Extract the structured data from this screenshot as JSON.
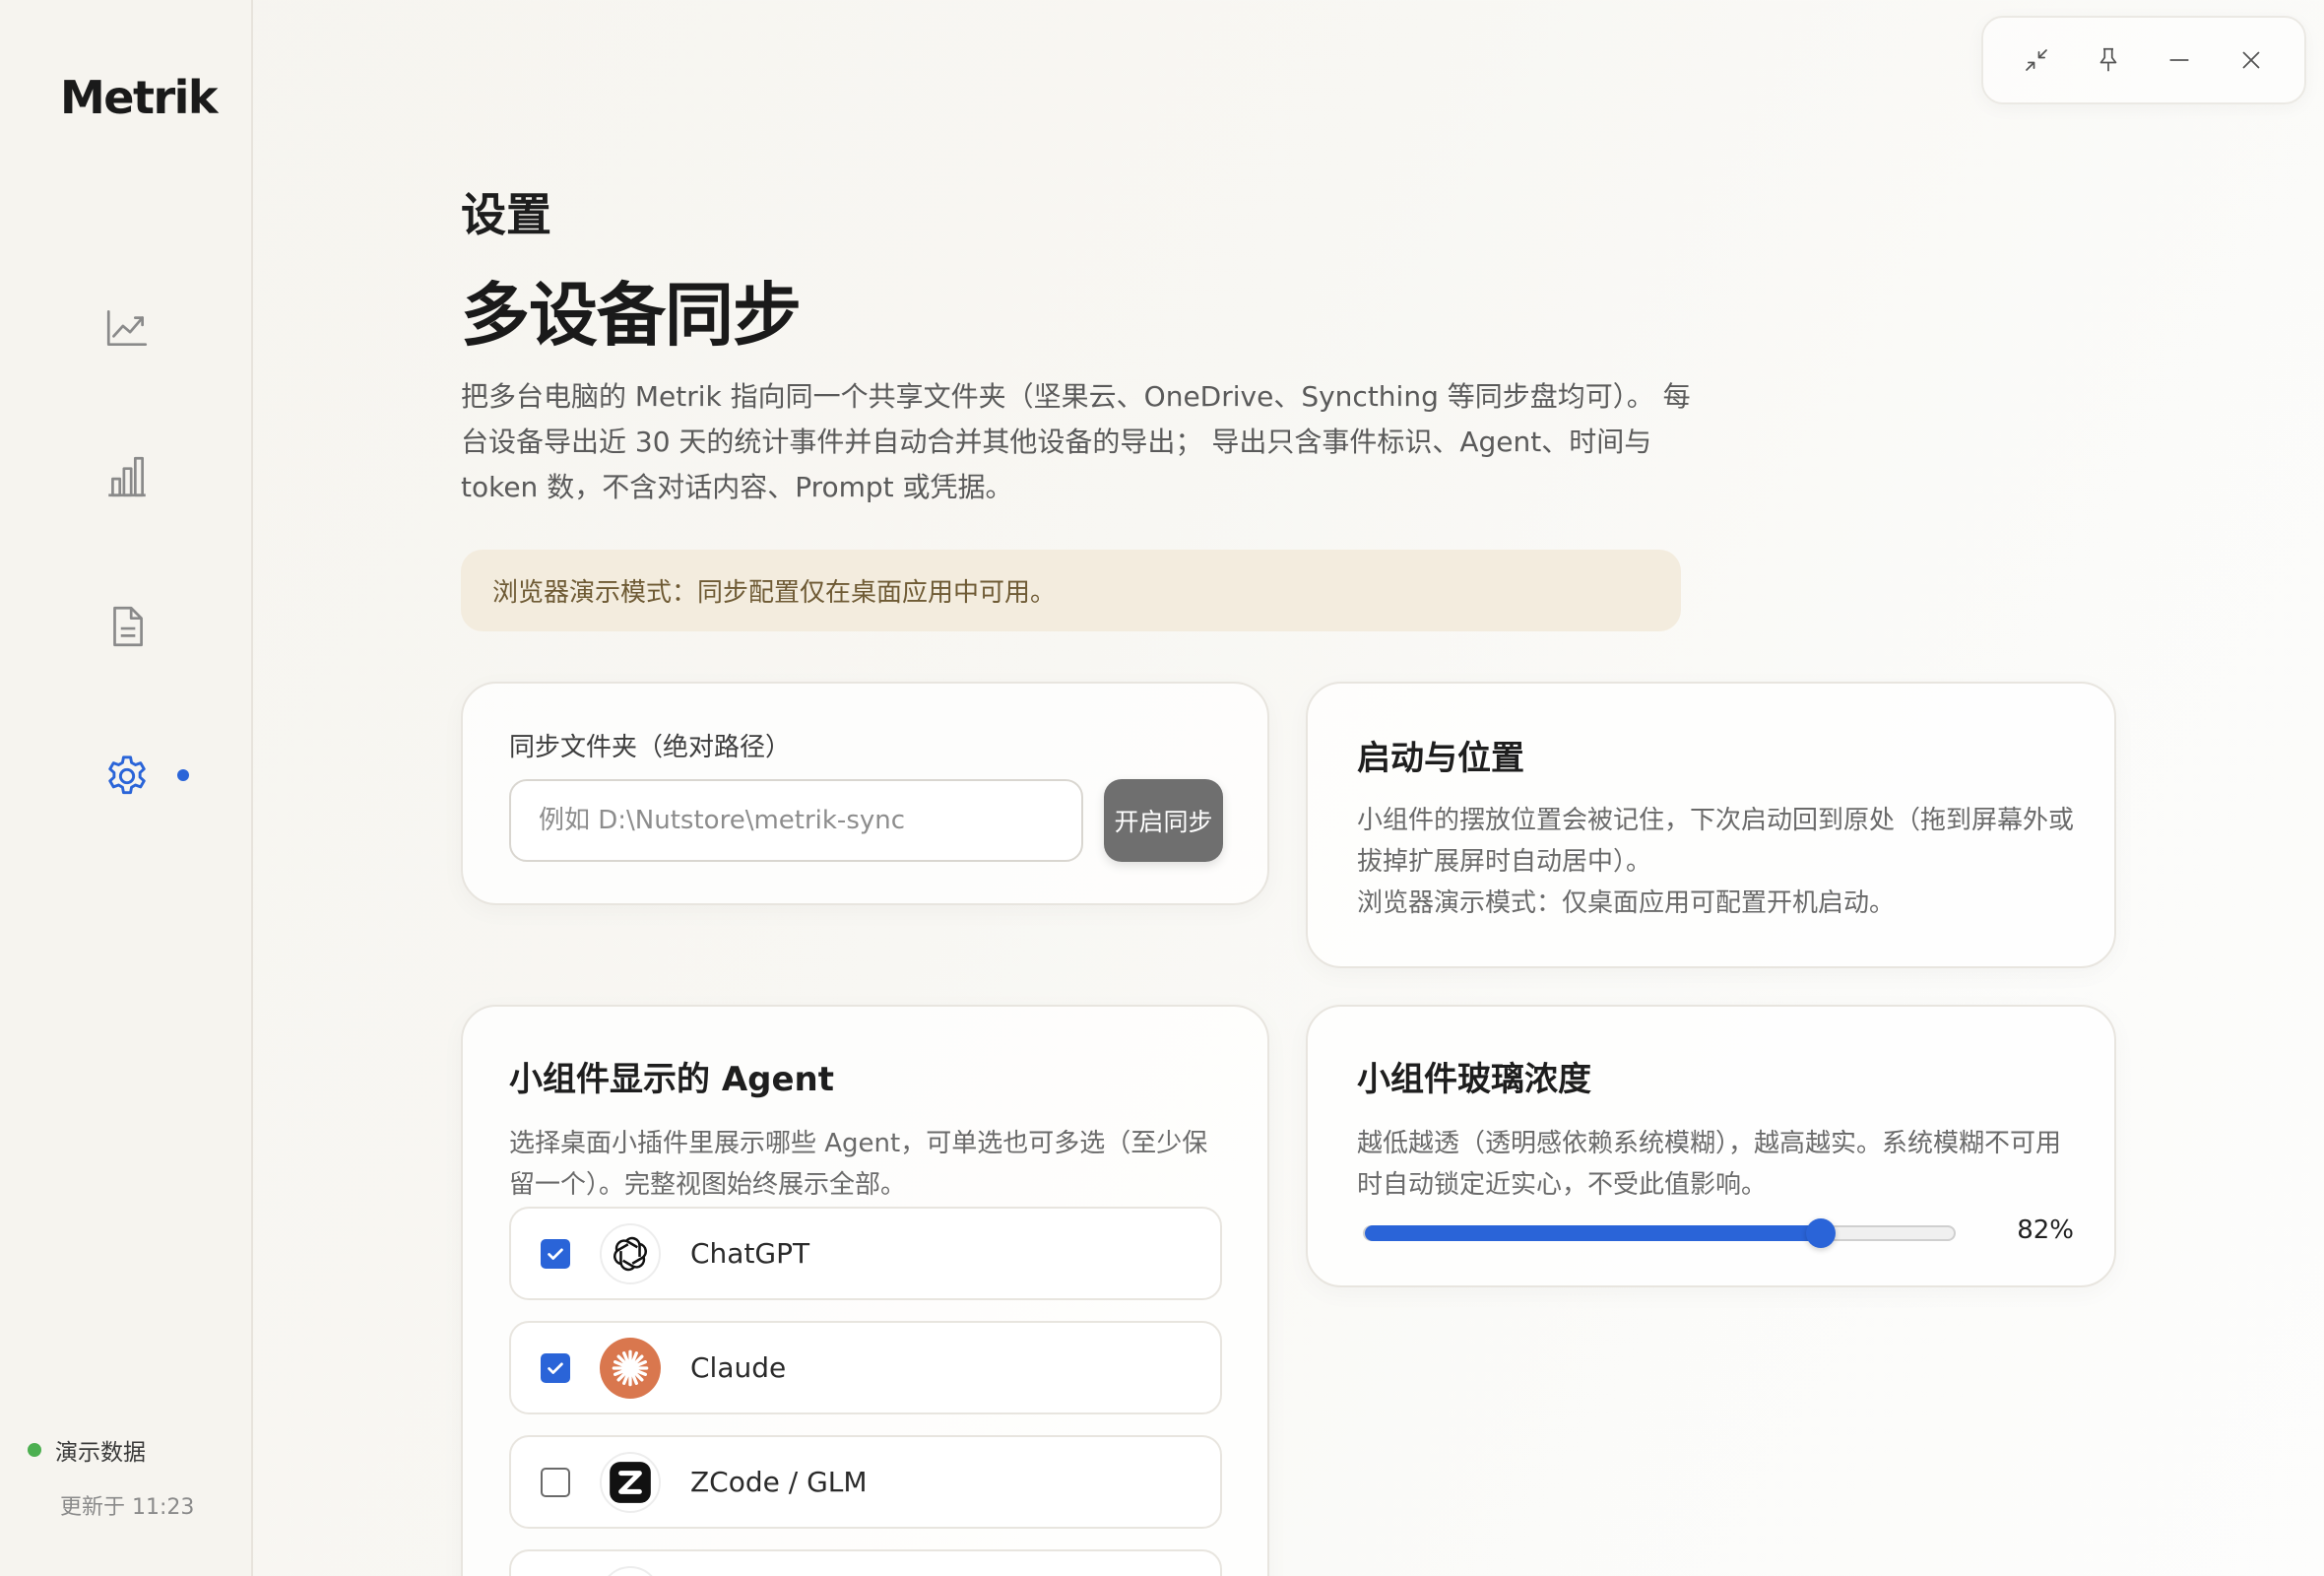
{
  "app": {
    "name": "Metrik"
  },
  "sidebar": {
    "items": [
      {
        "id": "trends",
        "icon": "line-chart-icon",
        "active": false
      },
      {
        "id": "stats",
        "icon": "bar-chart-icon",
        "active": false
      },
      {
        "id": "reports",
        "icon": "document-icon",
        "active": false
      },
      {
        "id": "settings",
        "icon": "gear-icon",
        "active": true
      }
    ],
    "status_label": "演示数据",
    "updated_text": "更新于 11:23"
  },
  "window_controls": {
    "icons": [
      "collapse-icon",
      "pin-icon",
      "minimize-icon",
      "close-icon"
    ]
  },
  "page": {
    "kicker": "设置",
    "title": "多设备同步",
    "description": "把多台电脑的 Metrik 指向同一个共享文件夹（坚果云、OneDrive、Syncthing 等同步盘均可）。 每台设备导出近 30 天的统计事件并自动合并其他设备的导出； 导出只含事件标识、Agent、时间与 token 数，不含对话内容、Prompt 或凭据。",
    "notice": "浏览器演示模式：同步配置仅在桌面应用中可用。"
  },
  "sync": {
    "label": "同步文件夹（绝对路径）",
    "value": "",
    "placeholder": "例如 D:\\Nutstore\\metrik-sync",
    "button": "开启同步"
  },
  "startup": {
    "title": "启动与位置",
    "text_line1": "小组件的摆放位置会被记住，下次启动回到原处（拖到屏幕外或拔掉扩展屏时自动居中）。",
    "text_line2": "浏览器演示模式：仅桌面应用可配置开机启动。"
  },
  "agents": {
    "title": "小组件显示的 Agent",
    "description": "选择桌面小插件里展示哪些 Agent，可单选也可多选（至少保留一个）。完整视图始终展示全部。",
    "list": [
      {
        "name": "ChatGPT",
        "checked": true,
        "icon": "openai-icon"
      },
      {
        "name": "Claude",
        "checked": true,
        "icon": "claude-icon"
      },
      {
        "name": "ZCode / GLM",
        "checked": false,
        "icon": "zcode-icon"
      }
    ]
  },
  "glass": {
    "title": "小组件玻璃浓度",
    "description": "越低越透（透明感依赖系统模糊），越高越实。系统模糊不可用时自动锁定近实心，不受此值影响。",
    "value": 82,
    "value_label": "82%"
  },
  "colors": {
    "accent": "#2a64d8",
    "notice_bg": "#f3ecde",
    "status_green": "#4caf50",
    "claude_orange": "#d9774e"
  }
}
